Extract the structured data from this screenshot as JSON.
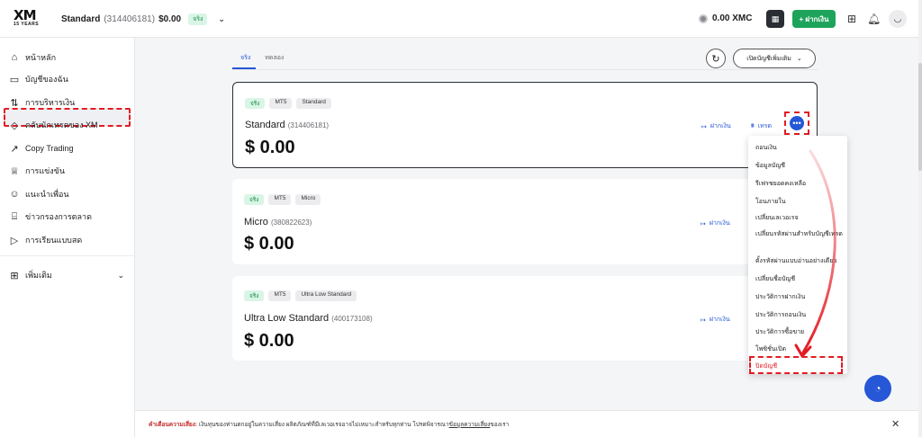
{
  "header": {
    "logo_text": "XM",
    "logo_sub": "15 YEARS",
    "account_name": "Standard",
    "account_number": "(314406181)",
    "account_balance": "$0.00",
    "account_tag": "จริง",
    "xmc": "0.00 XMC",
    "deposit_label": "+ ฝากเงิน"
  },
  "sidebar": {
    "items": [
      {
        "label": "หน้าหลัก",
        "icon": "home-icon"
      },
      {
        "label": "บัญชีของฉัน",
        "icon": "wallet-icon"
      },
      {
        "label": "การบริหารเงิน",
        "icon": "transfer-icon"
      },
      {
        "label": "คลับนักเทรดของ XM",
        "icon": "diamond-icon"
      },
      {
        "label": "Copy Trading",
        "icon": "trend-icon"
      },
      {
        "label": "การแข่งขัน",
        "icon": "trophy-icon"
      },
      {
        "label": "แนะนำเพื่อน",
        "icon": "people-icon"
      },
      {
        "label": "ข่าวกรองการตลาด",
        "icon": "bank-icon"
      },
      {
        "label": "การเรียนแบบสด",
        "icon": "video-icon"
      }
    ],
    "more_label": "เพิ่มเติม"
  },
  "main": {
    "tabs": [
      {
        "label": "จริง"
      },
      {
        "label": "ทดลอง"
      }
    ],
    "open_account_label": "เปิดบัญชีเพิ่มเติม",
    "deposit_action": "ฝากเงิน",
    "trade_action": "เทรด",
    "accounts": [
      {
        "chips": [
          "จริง",
          "MT5",
          "Standard"
        ],
        "name": "Standard",
        "number": "(314406181)",
        "balance": "$ 0.00"
      },
      {
        "chips": [
          "จริง",
          "MT5",
          "Micro"
        ],
        "name": "Micro",
        "number": "(380822623)",
        "balance": "$ 0.00"
      },
      {
        "chips": [
          "จริง",
          "MT5",
          "Ultra Low Standard"
        ],
        "name": "Ultra Low Standard",
        "number": "(400173108)",
        "balance": "$ 0.00"
      }
    ]
  },
  "menu": {
    "items": [
      "ถอนเงิน",
      "ข้อมูลบัญชี",
      "รีเฟรชยอดคงเหลือ",
      "โอนภายใน",
      "เปลี่ยนเลเวอเรจ",
      "เปลี่ยนรหัสผ่านสำหรับบัญชีเทรด",
      "ตั้งรหัสผ่านแบบอ่านอย่างเดียว",
      "เปลี่ยนชื่อบัญชี",
      "ประวัติการฝากเงิน",
      "ประวัติการถอนเงิน",
      "ประวัติการซื้อขาย",
      "โพซิชั่นเปิด",
      "ปิดบัญชี"
    ]
  },
  "footer": {
    "warning_label": "คำเตือนความเสี่ยง:",
    "warning_text": " เงินทุนของท่านตกอยู่ในความเสี่ยง ผลิตภัณฑ์ที่มีเลเวอเรจอาจไม่เหมาะสำหรับทุกท่าน โปรดพิจารณา",
    "link_text": "ข้อมูลความเสี่ยง",
    "tail_text": "ของเรา"
  },
  "colors": {
    "accent": "#2557d6",
    "green": "#1ea35b",
    "danger": "#e31b23"
  }
}
